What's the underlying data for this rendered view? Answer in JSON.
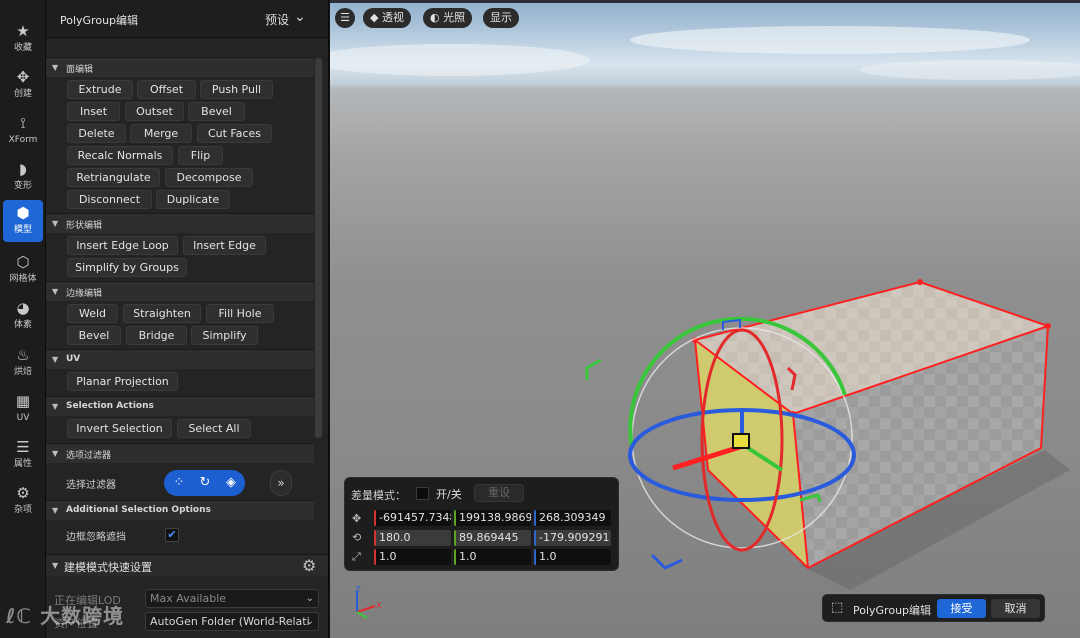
{
  "toolbar": {
    "items": [
      {
        "label": "收藏",
        "icon": "star-icon"
      },
      {
        "label": "创建",
        "icon": "create-icon"
      },
      {
        "label": "XForm",
        "icon": "xform-icon"
      },
      {
        "label": "变形",
        "icon": "deform-icon"
      },
      {
        "label": "模型",
        "icon": "model-icon",
        "active": true
      },
      {
        "label": "网格体",
        "icon": "mesh-icon"
      },
      {
        "label": "体素",
        "icon": "voxel-icon"
      },
      {
        "label": "烘焙",
        "icon": "bake-icon"
      },
      {
        "label": "UV",
        "icon": "uv-icon"
      },
      {
        "label": "属性",
        "icon": "attributes-icon"
      },
      {
        "label": "杂项",
        "icon": "misc-icon"
      }
    ]
  },
  "panel": {
    "title": "PolyGroup编辑",
    "preset": "预设"
  },
  "sections": {
    "face_edit": {
      "title": "面编辑",
      "buttons": [
        "Extrude",
        "Offset",
        "Push Pull",
        "Inset",
        "Outset",
        "Bevel",
        "Delete",
        "Merge",
        "Cut Faces",
        "Recalc Normals",
        "Flip",
        "Retriangulate",
        "Decompose",
        "Disconnect",
        "Duplicate"
      ]
    },
    "shape_edit": {
      "title": "形状编辑",
      "buttons": [
        "Insert Edge Loop",
        "Insert Edge",
        "Simplify by Groups"
      ]
    },
    "edge_edit": {
      "title": "边缘编辑",
      "buttons": [
        "Weld",
        "Straighten",
        "Fill Hole",
        "Bevel",
        "Bridge",
        "Simplify"
      ]
    },
    "uv": {
      "title": "UV",
      "buttons": [
        "Planar Projection"
      ]
    },
    "selection_actions": {
      "title": "Selection Actions",
      "buttons": [
        "Invert Selection",
        "Select All"
      ]
    },
    "selection_filter": {
      "title": "选项过滤器",
      "row_label": "选择过滤器",
      "more": "»"
    },
    "additional": {
      "title": "Additional Selection Options",
      "row_label": "边框忽略遮挡",
      "checked": true
    },
    "quick": {
      "title": "建模模式快速设置",
      "lod_label": "正在编辑LOD",
      "lod_value": "Max Available",
      "asset_label": "资产位置",
      "asset_value": "AutoGen Folder (World-Relati"
    }
  },
  "viewport": {
    "view_mode": "透视",
    "lighting": "光照",
    "show": "显示"
  },
  "delta": {
    "mode_label": "差量模式：",
    "onoff": "开/关",
    "reset": "重设",
    "location": [
      "-691457.7348",
      "199138.9869",
      "268.309349"
    ],
    "rotation": [
      "180.0",
      "89.869445",
      "-179.909291"
    ],
    "scale": [
      "1.0",
      "1.0",
      "1.0"
    ]
  },
  "accept_bar": {
    "label": "PolyGroup编辑",
    "accept": "接受",
    "cancel": "取消"
  },
  "watermark": "大数跨境",
  "colors": {
    "accent": "#1f66d6",
    "selection_edge": "#ff2020",
    "axis_x": "#d23434",
    "axis_y": "#5fa325",
    "axis_z": "#2e67c9"
  }
}
